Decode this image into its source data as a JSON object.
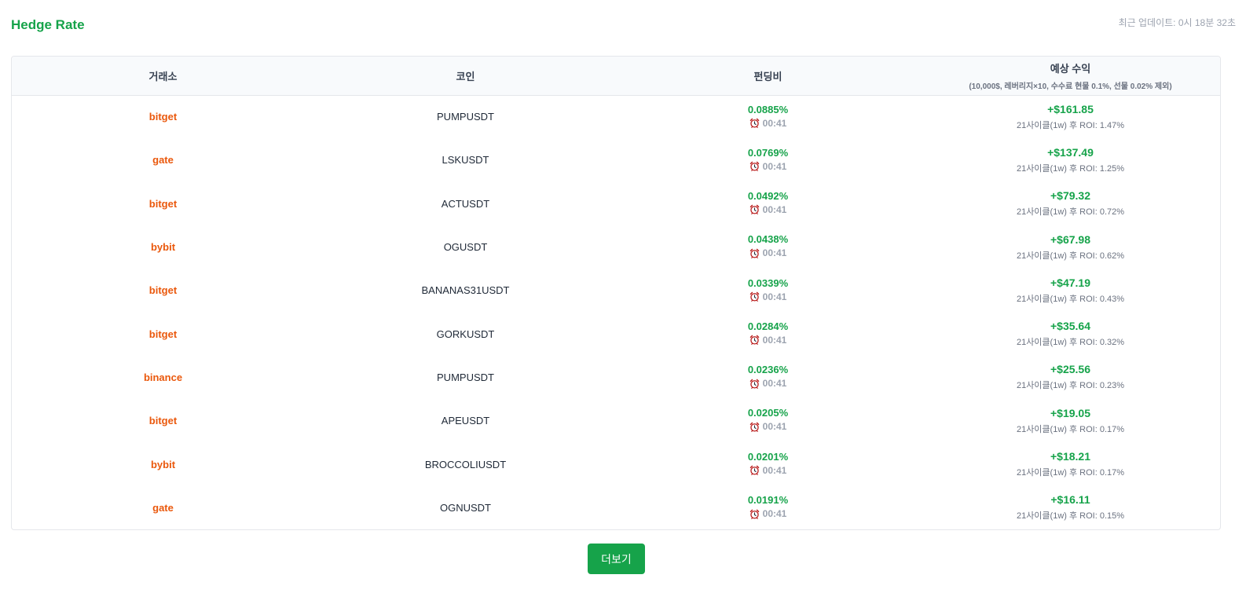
{
  "header": {
    "title": "Hedge Rate",
    "last_update": "최근 업데이트: 0시 18분 32초"
  },
  "table": {
    "columns": {
      "exchange": "거래소",
      "coin": "코인",
      "funding": "펀딩비",
      "profit": "예상 수익",
      "profit_note": "(10,000$, 레버리지×10, 수수료 현물 0.1%, 선물 0.02% 제외)"
    },
    "rows": [
      {
        "exchange": "bitget",
        "coin": "PUMPUSDT",
        "rate": "0.0885%",
        "timer": "00:41",
        "profit": "+$161.85",
        "roi": "21사이클(1w) 후 ROI: 1.47%"
      },
      {
        "exchange": "gate",
        "coin": "LSKUSDT",
        "rate": "0.0769%",
        "timer": "00:41",
        "profit": "+$137.49",
        "roi": "21사이클(1w) 후 ROI: 1.25%"
      },
      {
        "exchange": "bitget",
        "coin": "ACTUSDT",
        "rate": "0.0492%",
        "timer": "00:41",
        "profit": "+$79.32",
        "roi": "21사이클(1w) 후 ROI: 0.72%"
      },
      {
        "exchange": "bybit",
        "coin": "OGUSDT",
        "rate": "0.0438%",
        "timer": "00:41",
        "profit": "+$67.98",
        "roi": "21사이클(1w) 후 ROI: 0.62%"
      },
      {
        "exchange": "bitget",
        "coin": "BANANAS31USDT",
        "rate": "0.0339%",
        "timer": "00:41",
        "profit": "+$47.19",
        "roi": "21사이클(1w) 후 ROI: 0.43%"
      },
      {
        "exchange": "bitget",
        "coin": "GORKUSDT",
        "rate": "0.0284%",
        "timer": "00:41",
        "profit": "+$35.64",
        "roi": "21사이클(1w) 후 ROI: 0.32%"
      },
      {
        "exchange": "binance",
        "coin": "PUMPUSDT",
        "rate": "0.0236%",
        "timer": "00:41",
        "profit": "+$25.56",
        "roi": "21사이클(1w) 후 ROI: 0.23%"
      },
      {
        "exchange": "bitget",
        "coin": "APEUSDT",
        "rate": "0.0205%",
        "timer": "00:41",
        "profit": "+$19.05",
        "roi": "21사이클(1w) 후 ROI: 0.17%"
      },
      {
        "exchange": "bybit",
        "coin": "BROCCOLIUSDT",
        "rate": "0.0201%",
        "timer": "00:41",
        "profit": "+$18.21",
        "roi": "21사이클(1w) 후 ROI: 0.17%"
      },
      {
        "exchange": "gate",
        "coin": "OGNUSDT",
        "rate": "0.0191%",
        "timer": "00:41",
        "profit": "+$16.11",
        "roi": "21사이클(1w) 후 ROI: 0.15%"
      }
    ]
  },
  "icons": {
    "timer": "alarm-clock-icon"
  },
  "colors": {
    "accent_green": "#16a34a",
    "exchange_orange": "#ea580c"
  },
  "footer": {
    "more_label": "더보기"
  }
}
